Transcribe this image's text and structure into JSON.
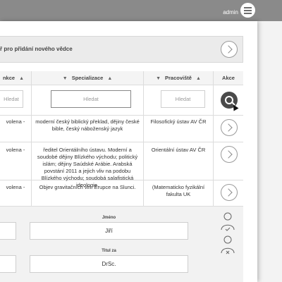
{
  "header": {
    "user": "admin",
    "menu_icon": "hamburger-menu-icon"
  },
  "page": {
    "title": "ř pro přidání nového vědce"
  },
  "table": {
    "columns": [
      {
        "label": "nkce"
      },
      {
        "label": "Specializace"
      },
      {
        "label": "Pracoviště"
      },
      {
        "label": "Akce"
      }
    ],
    "filters": {
      "specializace": "Hledat",
      "pracoviste": "Hledat",
      "first": "Hledat"
    },
    "rows": [
      {
        "c0": "volena -",
        "specializace": "moderní český biblický překlad, dějiny české bible, český náboženský jazyk",
        "pracoviste": "Filosofický ústav AV ČR"
      },
      {
        "c0": "volena -",
        "specializace": "ředitel Orientálního ústavu. Moderní a soudobé dějiny Blízkého východu; politický islám; dějiny Saúdské Arábie. Arabská povstání 2011 a jejich vliv na podobu Blízkého východu; soudobá salafistická ideologie.",
        "pracoviste": "Orientální ústav AV ČR"
      },
      {
        "c0": "volena -",
        "specializace": "Objev gravitačních vln. Erupce na Slunci.",
        "pracoviste": "(Matematicko fyzikální fakulta UK"
      }
    ]
  },
  "form": {
    "jmeno_label": "Jméno",
    "jmeno_value": "Jiří",
    "titul_za_label": "Titul za",
    "titul_za_value": "DrSc."
  }
}
